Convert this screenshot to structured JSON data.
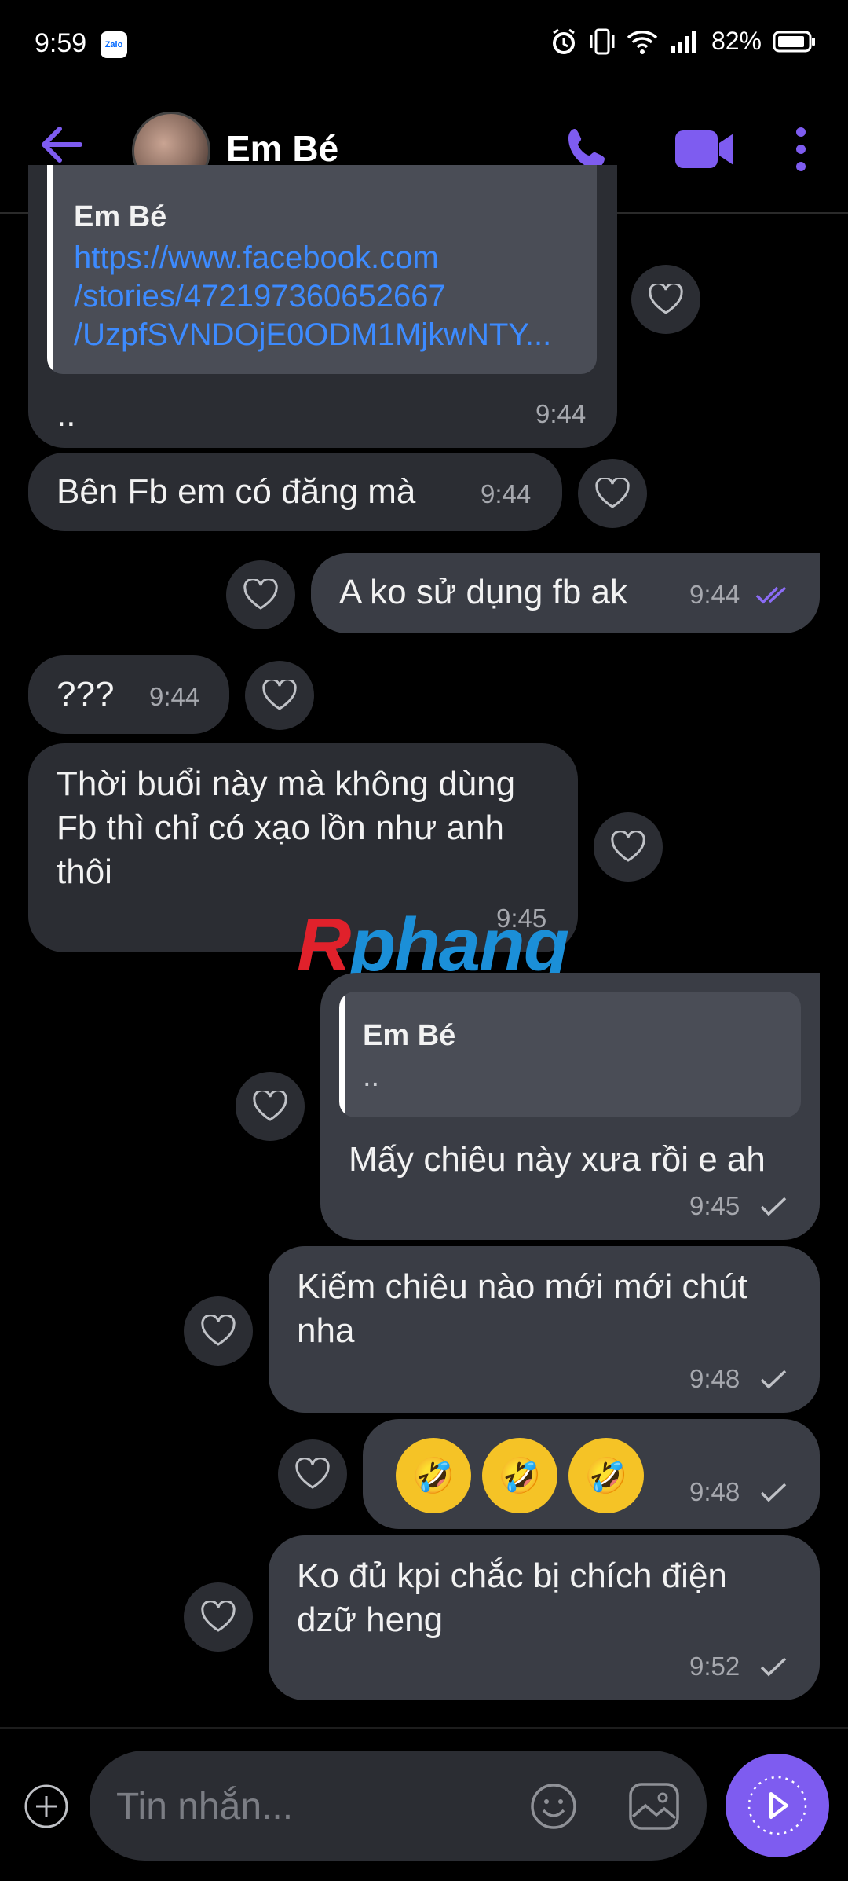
{
  "status": {
    "time": "9:59",
    "zalo": "Zalo",
    "battery": "82%"
  },
  "header": {
    "title": "Em Bé"
  },
  "messages": {
    "m1": {
      "quote_name": "Em Bé",
      "link_lines": [
        "https://www.facebook.com",
        "/stories/472197360652667",
        "/UzpfSVNDOjE0ODM1MjkwNTY..."
      ],
      "text": "..",
      "time": "9:44"
    },
    "m2": {
      "text": "Bên Fb em có đăng mà",
      "time": "9:44"
    },
    "m3": {
      "text": "A ko sử dụng fb ak",
      "time": "9:44"
    },
    "m4": {
      "text": "???",
      "time": "9:44"
    },
    "m5": {
      "line1": "Thời buổi này mà không dùng",
      "line2": "Fb thì chỉ có xạo lồn như anh",
      "line3": "thôi",
      "time": "9:45"
    },
    "m6": {
      "quote_name": "Em Bé",
      "quote_text": "..",
      "text": "Mấy chiêu này xưa rồi e ah",
      "time": "9:45"
    },
    "m7": {
      "line1": "Kiếm chiêu nào mới mới chút",
      "line2": "nha",
      "time": "9:48"
    },
    "m8": {
      "emojis": [
        "🤣",
        "🤣",
        "🤣"
      ],
      "time": "9:48"
    },
    "m9": {
      "line1": "Ko đủ kpi chắc bị chích điện",
      "line2": "dzữ heng",
      "time": "9:52"
    }
  },
  "watermark": {
    "part1": "R",
    "part2": "phang"
  },
  "input": {
    "placeholder": "Tin nhắn..."
  },
  "colors": {
    "accent": "#7e5cf0",
    "incoming": "#2b2d33",
    "outgoing": "#3a3d45",
    "link": "#3d8bff"
  }
}
